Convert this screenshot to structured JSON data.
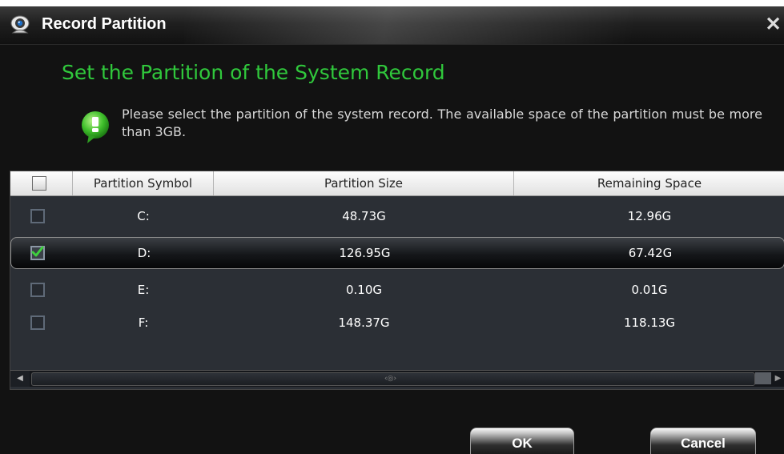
{
  "window": {
    "title": "Record Partition",
    "close_glyph": "✕",
    "icon": "camera-icon"
  },
  "heading": "Set the Partition of the System Record",
  "info": {
    "icon": "info-bubble-icon",
    "text": "Please select the partition of the system record. The available space of the partition must be more than 3GB."
  },
  "table": {
    "columns": [
      "Partition Symbol",
      "Partition Size",
      "Remaining Space"
    ],
    "rows": [
      {
        "symbol": "C:",
        "size": "48.73G",
        "remaining": "12.96G",
        "checked": false
      },
      {
        "symbol": "D:",
        "size": "126.95G",
        "remaining": "67.42G",
        "checked": true
      },
      {
        "symbol": "E:",
        "size": "0.10G",
        "remaining": "0.01G",
        "checked": false
      },
      {
        "symbol": "F:",
        "size": "148.37G",
        "remaining": "118.13G",
        "checked": false
      }
    ]
  },
  "buttons": {
    "ok": "OK",
    "cancel": "Cancel"
  },
  "colors": {
    "heading": "#30c83c",
    "check": "#3ecf3e",
    "background": "#121212"
  }
}
